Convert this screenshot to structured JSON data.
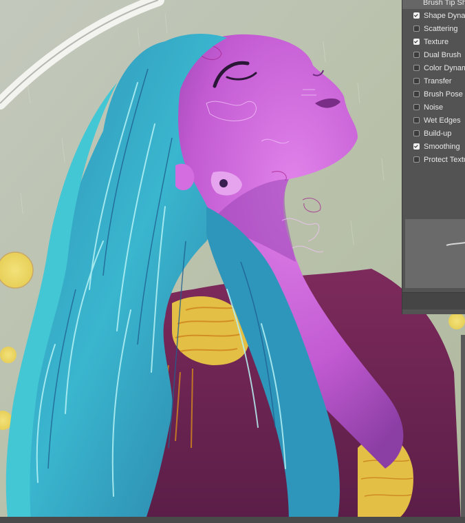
{
  "brush_settings_panel": {
    "header_label": "Brush Tip Shape",
    "options": [
      {
        "label": "Shape Dynamics",
        "checked": true
      },
      {
        "label": "Scattering",
        "checked": false
      },
      {
        "label": "Texture",
        "checked": true
      },
      {
        "label": "Dual Brush",
        "checked": false
      },
      {
        "label": "Color Dynamics",
        "checked": false
      },
      {
        "label": "Transfer",
        "checked": false
      },
      {
        "label": "Brush Pose",
        "checked": false
      },
      {
        "label": "Noise",
        "checked": false
      },
      {
        "label": "Wet Edges",
        "checked": false
      },
      {
        "label": "Build-up",
        "checked": false
      },
      {
        "label": "Smoothing",
        "checked": true
      },
      {
        "label": "Protect Texture",
        "checked": false
      }
    ]
  },
  "colors": {
    "hair": "#3aa7c4",
    "skin": "#c85bd6",
    "robe": "#6a2350",
    "gold": "#e7c446",
    "background": "#bfc7b3"
  }
}
